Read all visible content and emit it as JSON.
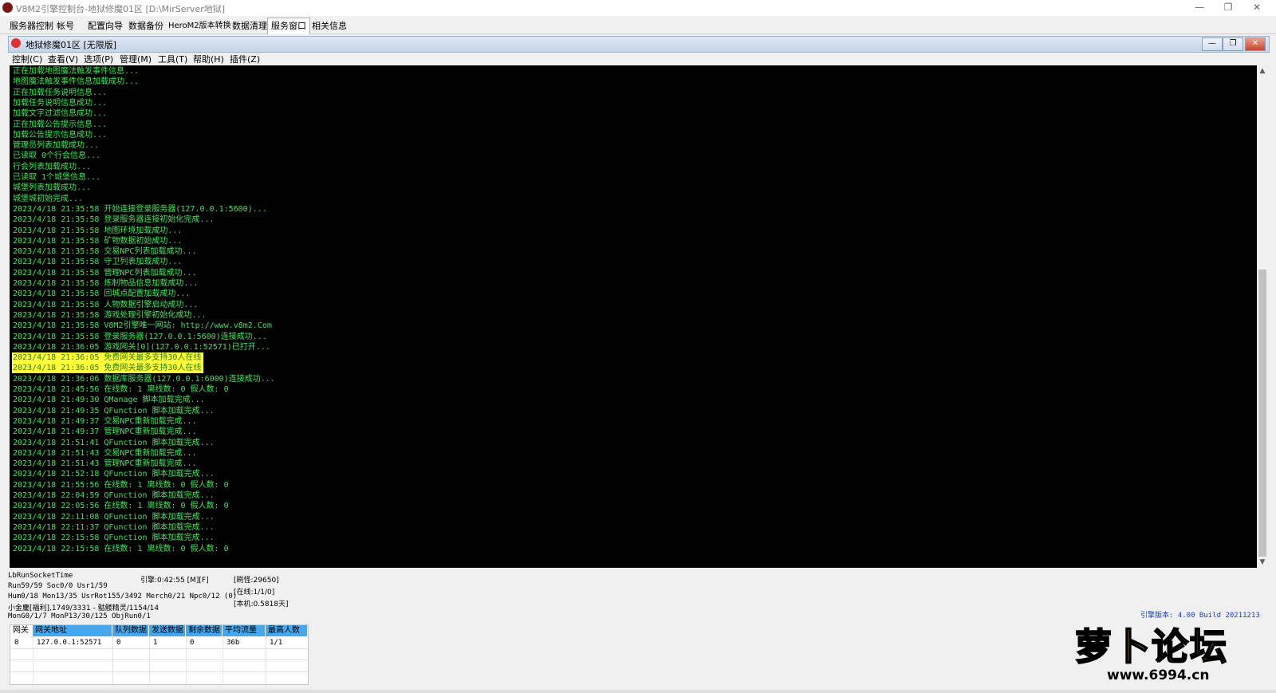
{
  "window": {
    "title": "V8M2引擎控制台-地狱修魔01区 [D:\\MirServer地狱]",
    "controls": {
      "minimize": "—",
      "restore": "❐",
      "close": "✕"
    }
  },
  "tabs": [
    "服务器控制",
    "帐号",
    "配置向导",
    "数据备份",
    "HeroM2版本转换",
    "数据清理",
    "服务窗口",
    "相关信息"
  ],
  "mdi": {
    "title": "地狱修魔01区 [无限版]",
    "menu": [
      "控制(C)",
      "查看(V)",
      "选项(P)",
      "管理(M)",
      "工具(T)",
      "帮助(H)",
      "插件(Z)"
    ]
  },
  "log": [
    {
      "text": "正在加载地图魔法触发事件信息...",
      "hl": false
    },
    {
      "text": "地图魔法触发事件信息加载成功...",
      "hl": false
    },
    {
      "text": "正在加载任务说明信息...",
      "hl": false
    },
    {
      "text": "加载任务说明信息成功...",
      "hl": false
    },
    {
      "text": "加载文字过滤信息成功...",
      "hl": false
    },
    {
      "text": "正在加载公告提示信息...",
      "hl": false
    },
    {
      "text": "加载公告提示信息成功...",
      "hl": false
    },
    {
      "text": "管理员列表加载成功...",
      "hl": false
    },
    {
      "text": "已读取 0个行会信息...",
      "hl": false
    },
    {
      "text": "行会列表加载成功...",
      "hl": false
    },
    {
      "text": "已读取 1个城堡信息...",
      "hl": false
    },
    {
      "text": "城堡列表加载成功...",
      "hl": false
    },
    {
      "text": "城堡城初始完成...",
      "hl": false
    },
    {
      "text": "2023/4/18 21:35:58 开始连接登录服务器(127.0.0.1:5600)...",
      "hl": false
    },
    {
      "text": "2023/4/18 21:35:58 登录服务器连接初始化完成...",
      "hl": false
    },
    {
      "text": "2023/4/18 21:35:58 地图环境加载成功...",
      "hl": false
    },
    {
      "text": "2023/4/18 21:35:58 矿物数据初始成功...",
      "hl": false
    },
    {
      "text": "2023/4/18 21:35:58 交易NPC列表加载成功...",
      "hl": false
    },
    {
      "text": "2023/4/18 21:35:58 守卫列表加载成功...",
      "hl": false
    },
    {
      "text": "2023/4/18 21:35:58 管理NPC列表加载成功...",
      "hl": false
    },
    {
      "text": "2023/4/18 21:35:58 炼制物品信息加载成功...",
      "hl": false
    },
    {
      "text": "2023/4/18 21:35:58 回城点配置加载成功...",
      "hl": false
    },
    {
      "text": "2023/4/18 21:35:58 人物数据引擎启动成功...",
      "hl": false
    },
    {
      "text": "2023/4/18 21:35:58 游戏处理引擎初始化成功...",
      "hl": false
    },
    {
      "text": "2023/4/18 21:35:58 V8M2引擎唯一网站: http://www.v8m2.Com",
      "hl": false
    },
    {
      "text": "2023/4/18 21:35:58 登录服务器(127.0.0.1:5600)连接成功...",
      "hl": false
    },
    {
      "text": "2023/4/18 21:36:05 游戏网关[0](127.0.0.1:52571)已打开...",
      "hl": false
    },
    {
      "text": "2023/4/18 21:36:05 免费网关最多支持30人在线",
      "hl": true
    },
    {
      "text": "2023/4/18 21:36:05 免费网关最多支持30人在线",
      "hl": true
    },
    {
      "text": "2023/4/18 21:36:06 数据库服务器(127.0.0.1:6000)连接成功...",
      "hl": false
    },
    {
      "text": "2023/4/18 21:45:56 在线数: 1 离线数: 0 假人数: 0",
      "hl": false
    },
    {
      "text": "2023/4/18 21:49:30 QManage 脚本加载完成...",
      "hl": false
    },
    {
      "text": "2023/4/18 21:49:35 QFunction 脚本加载完成...",
      "hl": false
    },
    {
      "text": "2023/4/18 21:49:37 交易NPC重新加载完成...",
      "hl": false
    },
    {
      "text": "2023/4/18 21:49:37 管理NPC重新加载完成...",
      "hl": false
    },
    {
      "text": "2023/4/18 21:51:41 QFunction 脚本加载完成...",
      "hl": false
    },
    {
      "text": "2023/4/18 21:51:43 交易NPC重新加载完成...",
      "hl": false
    },
    {
      "text": "2023/4/18 21:51:43 管理NPC重新加载完成...",
      "hl": false
    },
    {
      "text": "2023/4/18 21:52:18 QFunction 脚本加载完成...",
      "hl": false
    },
    {
      "text": "2023/4/18 21:55:56 在线数: 1 离线数: 0 假人数: 0",
      "hl": false
    },
    {
      "text": "2023/4/18 22:04:59 QFunction 脚本加载完成...",
      "hl": false
    },
    {
      "text": "2023/4/18 22:05:56 在线数: 1 离线数: 0 假人数: 0",
      "hl": false
    },
    {
      "text": "2023/4/18 22:11:08 QFunction 脚本加载完成...",
      "hl": false
    },
    {
      "text": "2023/4/18 22:11:37 QFunction 脚本加载完成...",
      "hl": false
    },
    {
      "text": "2023/4/18 22:15:58 QFunction 脚本加载完成...",
      "hl": false
    },
    {
      "text": "2023/4/18 22:15:58 在线数: 1 离线数: 0 假人数: 0",
      "hl": false
    }
  ],
  "status": {
    "line1": "LbRunSocketTime",
    "line2": "Run59/59 Soc0/0 Usr1/59",
    "line3": "Hum0/18 Mon13/35 UsrRot155/3492 Merch0/21 Npc0/12 (0)",
    "line4": "小金鏖[福利],1749/3331 - 骷髅精灵/1154/14",
    "line5": "MonG0/1/7 MonP13/30/125 ObjRun0/1",
    "engine": "引擎:0:42:55 [M][F]",
    "refresh": "[刷怪:29650]",
    "online": "[在线:1/1/0]",
    "local": "[本机:0.5818天]",
    "version": "引擎版本: 4.00 Build 20211213"
  },
  "gateway_table": {
    "headers": [
      "网关",
      "网关地址",
      "队列数据",
      "发送数据",
      "剩余数据",
      "平均流量",
      "最高人数"
    ],
    "rows": [
      [
        "0",
        "127.0.0.1:52571",
        "0",
        "1",
        "0",
        "36b",
        "1/1"
      ]
    ]
  },
  "watermark": {
    "text": "萝卜论坛",
    "url": "www.6994.cn"
  },
  "colors": {
    "log_bg": "#000000",
    "log_text": "#3fe65a",
    "highlight": "#ffff3a",
    "header_blue": "#4aa6ea"
  }
}
